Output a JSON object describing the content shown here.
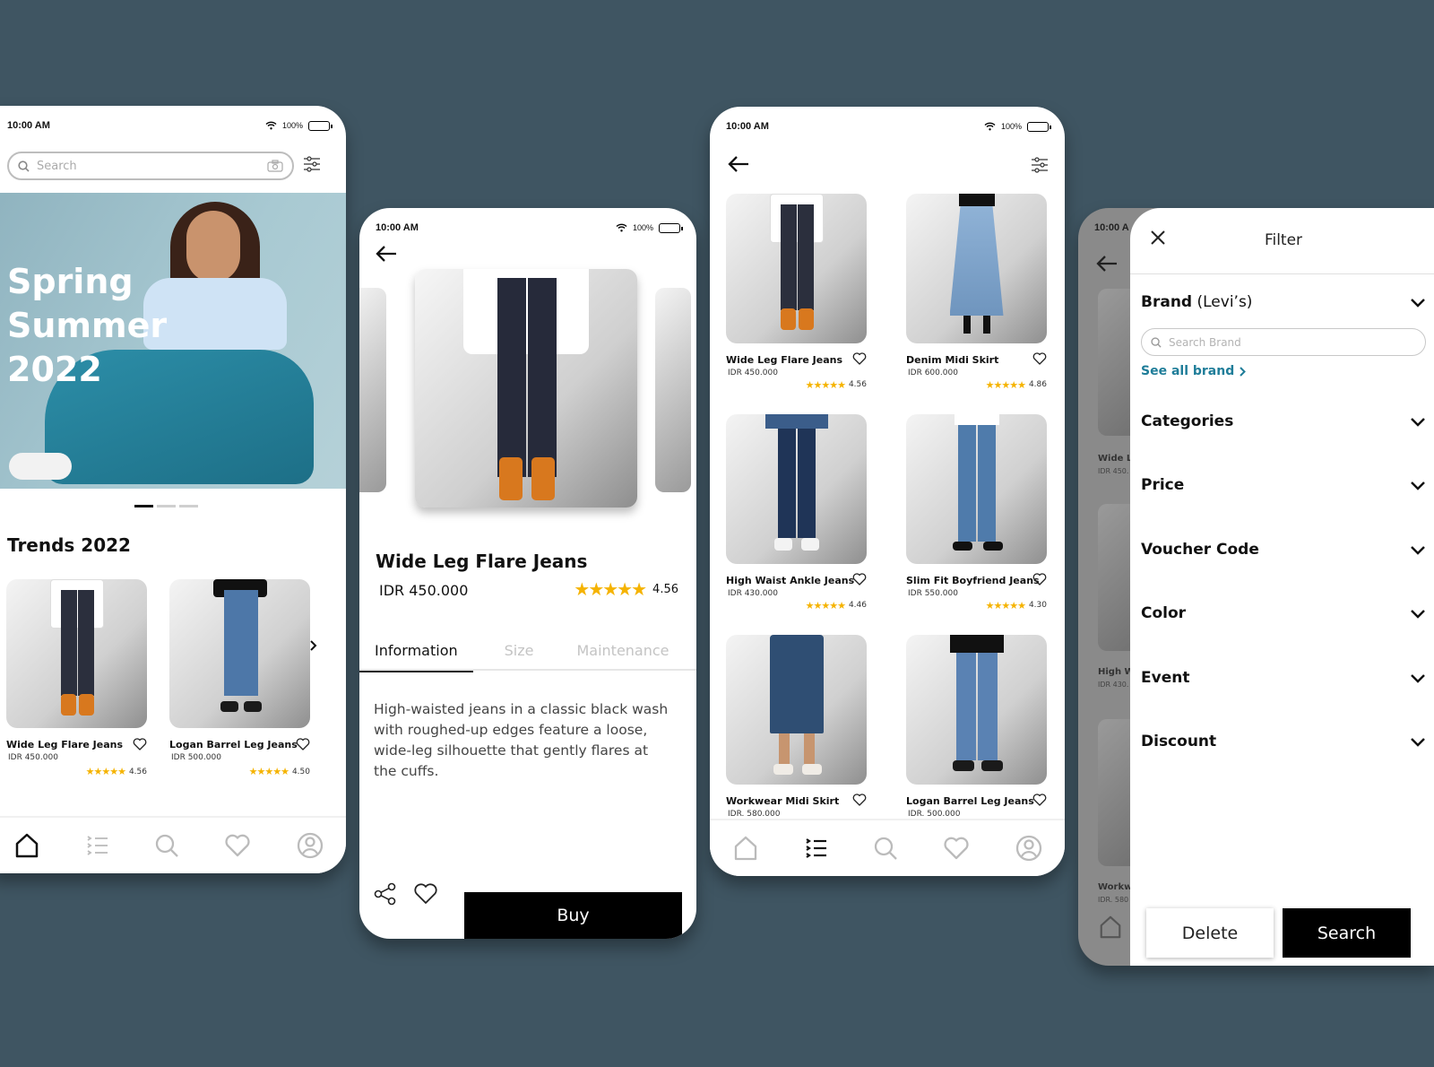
{
  "status_bar": {
    "time": "10:00 AM",
    "battery_text": "100%"
  },
  "home": {
    "search_placeholder": "Search",
    "hero_title_lines": [
      "Spring",
      "Summer",
      "2022"
    ],
    "carousel": {
      "slides": 3,
      "active": 1
    },
    "trends_title": "Trends 2022",
    "trends": [
      {
        "name": "Wide Leg Flare Jeans",
        "price": "IDR 450.000",
        "rating": "4.56",
        "stars": "★★★★½"
      },
      {
        "name": "Logan Barrel Leg Jeans",
        "price": "IDR 500.000",
        "rating": "4.50",
        "stars": "★★★★½"
      }
    ],
    "nav": [
      "home-icon",
      "list-icon",
      "search-icon",
      "heart-icon",
      "profile-icon"
    ],
    "active_nav": "home"
  },
  "detail": {
    "title": "Wide Leg Flare Jeans",
    "price": "IDR 450.000",
    "rating": "4.56",
    "tabs": [
      "Information",
      "Size",
      "Maintenance"
    ],
    "active_tab": "Information",
    "description": "High-waisted jeans in a classic black wash with roughed-up edges feature a loose, wide-leg silhouette that gently flares at the cuffs.",
    "buy_label": "Buy"
  },
  "catalog": {
    "products": [
      {
        "name": "Wide Leg Flare Jeans",
        "price": "IDR 450.000",
        "rating": "4.56"
      },
      {
        "name": "Denim Midi Skirt",
        "price": "IDR 600.000",
        "rating": "4.86"
      },
      {
        "name": "High Waist Ankle Jeans",
        "price": "IDR 430.000",
        "rating": "4.46"
      },
      {
        "name": "Slim Fit Boyfriend Jeans",
        "price": "IDR 550.000",
        "rating": "4.30"
      },
      {
        "name": "Workwear Midi Skirt",
        "price": "IDR. 580.000",
        "rating": ""
      },
      {
        "name": "Logan Barrel Leg Jeans",
        "price": "IDR. 500.000",
        "rating": ""
      }
    ],
    "active_nav": "list"
  },
  "filter": {
    "title": "Filter",
    "brand_label": "Brand",
    "brand_value": "(Levi’s)",
    "brand_search_placeholder": "Search Brand",
    "see_all_label": "See all brand",
    "sections": [
      "Categories",
      "Price",
      "Voucher Code",
      "Color",
      "Event",
      "Discount"
    ],
    "delete_label": "Delete",
    "search_label": "Search",
    "background_items": [
      {
        "name": "Wide L",
        "price": "IDR 450."
      },
      {
        "name": "High W",
        "price": "IDR 430."
      },
      {
        "name": "Workw",
        "price": "IDR. 580"
      }
    ],
    "background_time": "10:00 A"
  },
  "colors": {
    "background": "#3f5562",
    "star": "#f5b301",
    "link": "#1f7d99",
    "primary_button": "#000000"
  }
}
